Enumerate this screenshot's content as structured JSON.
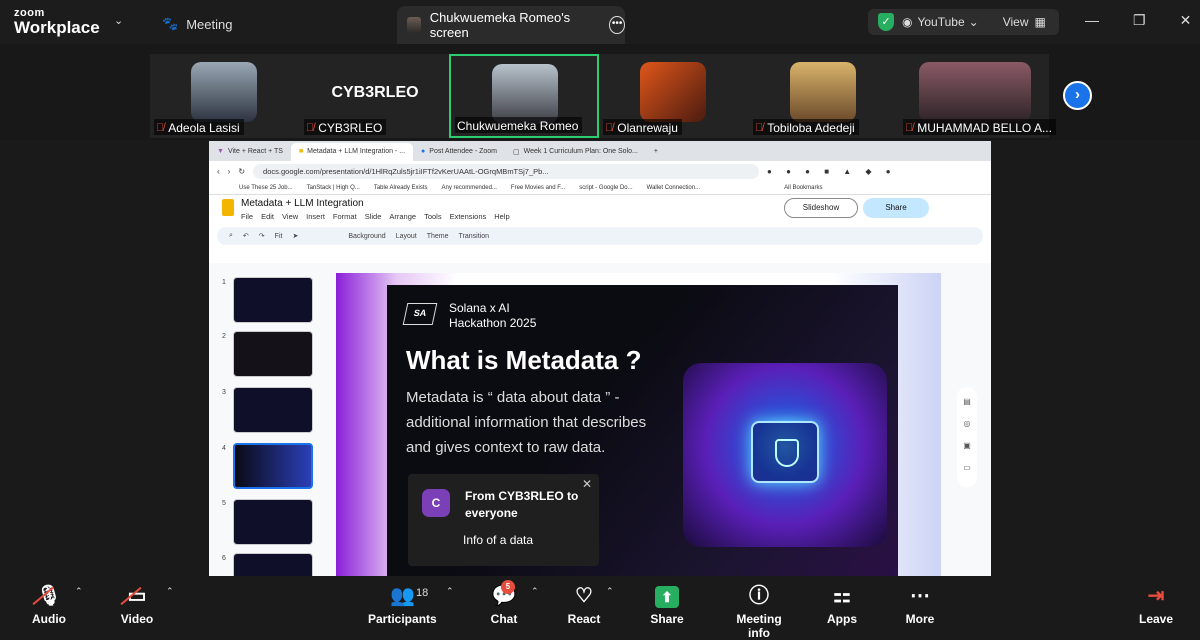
{
  "top": {
    "brand_top": "zoom",
    "brand_bottom": "Workplace",
    "meeting_label": "Meeting",
    "screen_tab": "Chukwuemeka Romeo's screen",
    "source_label": "YouTube",
    "view_label": "View"
  },
  "participants": [
    {
      "name": "Adeola Lasisi"
    },
    {
      "name": "CYB3RLEO",
      "display": "CYB3RLEO"
    },
    {
      "name": "Chukwuemeka Romeo"
    },
    {
      "name": "Olanrewaju"
    },
    {
      "name": "Tobiloba Adedeji"
    },
    {
      "name": "MUHAMMAD BELLO A..."
    }
  ],
  "browser": {
    "tabs": [
      "Vite + React + TS",
      "Metadata + LLM Integration - ...",
      "Post Attendee - Zoom",
      "Week 1 Curriculum Plan: One Solo..."
    ],
    "url": "docs.google.com/presentation/d/1HlRqZuls5jr1iIFTf2vKerUAAtL-OGrqMBmTSj7_Pb...",
    "bookmarks": [
      "Use These 25 Job...",
      "TanStack | High Q...",
      "Table Already Exists",
      "Any recommended...",
      "Free Movies and F...",
      "script - Google Do...",
      "Wallet Connection...",
      "All Bookmarks"
    ]
  },
  "doc": {
    "title": "Metadata + LLM Integration",
    "menus": [
      "File",
      "Edit",
      "View",
      "Insert",
      "Format",
      "Slide",
      "Arrange",
      "Tools",
      "Extensions",
      "Help"
    ],
    "slideshow": "Slideshow",
    "share": "Share",
    "toolbar": [
      "Fit",
      "Background",
      "Layout",
      "Theme",
      "Transition"
    ]
  },
  "thumbnails": [
    {
      "num": "1"
    },
    {
      "num": "2"
    },
    {
      "num": "3"
    },
    {
      "num": "4"
    },
    {
      "num": "5"
    },
    {
      "num": "6"
    }
  ],
  "slide": {
    "logo": "SA",
    "event_line1": "Solana x AI",
    "event_line2": "Hackathon 2025",
    "title": "What is Metadata ?",
    "body": "Metadata is “ data about data ” - additional information that describes and gives context to raw data."
  },
  "chat_popup": {
    "avatar": "C",
    "from": "From CYB3RLEO to everyone",
    "message": "Info of  a data"
  },
  "controls": {
    "audio": "Audio",
    "video": "Video",
    "participants": "Participants",
    "participant_count": "18",
    "chat": "Chat",
    "chat_badge": "5",
    "react": "React",
    "share": "Share",
    "meeting_info": "Meeting info",
    "apps": "Apps",
    "more": "More",
    "leave": "Leave"
  },
  "colors": {
    "accent": "#1a73e8",
    "active_speaker": "#2ecc71",
    "muted": "#e74c3c",
    "share": "#27ae60"
  }
}
